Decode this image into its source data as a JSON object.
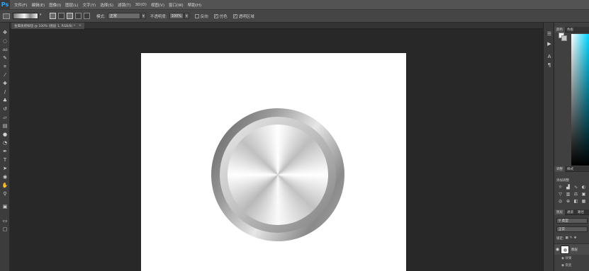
{
  "app": {
    "logo": "Ps"
  },
  "menu": [
    "文件(F)",
    "编辑(E)",
    "图像(I)",
    "图层(L)",
    "文字(Y)",
    "选择(S)",
    "滤镜(T)",
    "3D(D)",
    "视图(V)",
    "窗口(W)",
    "帮助(H)"
  ],
  "options": {
    "mode_label": "模式:",
    "mode_value": "正常",
    "opacity_label": "不透明度:",
    "opacity_value": "100%",
    "reverse_label": "反向",
    "dither_label": "仿色",
    "transparency_label": "透明区域",
    "reverse_checked": false,
    "dither_checked": true,
    "transparency_checked": true
  },
  "document": {
    "tab_title": "金属质感按钮 @ 100% (图层 1, RGB/8) *",
    "close_glyph": "×"
  },
  "panels": {
    "color_tabs": [
      "颜色",
      "色板"
    ],
    "adjust_tabs": [
      "调整",
      "样式"
    ],
    "adjust_title": "添加调整",
    "layers_tabs": [
      "图层",
      "通道",
      "路径"
    ],
    "layers_filter": "类型",
    "layers_mode": "正常",
    "lock_label": "锁定:",
    "layer_name": "图层",
    "effects_label": "效果",
    "sub_effect": "渐变"
  },
  "colors": {
    "foreground": "#f2f2f2",
    "background": "#c8c8c8",
    "accent": "#31a8ff"
  },
  "icons": {
    "tools": [
      "move-icon",
      "marquee-icon",
      "lasso-icon",
      "quick-select-icon",
      "crop-icon",
      "eyedropper-icon",
      "healing-icon",
      "brush-icon",
      "stamp-icon",
      "history-brush-icon",
      "eraser-icon",
      "gradient-icon",
      "blur-icon",
      "dodge-icon",
      "pen-icon",
      "type-icon",
      "path-select-icon",
      "shape-icon",
      "hand-icon",
      "zoom-icon"
    ]
  }
}
